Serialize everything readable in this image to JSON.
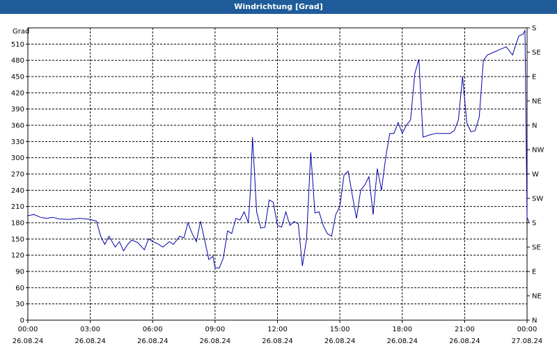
{
  "window": {
    "title": "Windrichtung [Grad]"
  },
  "chart_data": {
    "type": "line",
    "title": "Windrichtung [Grad]",
    "ylabel": "Grad",
    "ylim": [
      0,
      540
    ],
    "y_ticks": [
      0,
      30,
      60,
      90,
      120,
      150,
      180,
      210,
      240,
      270,
      300,
      330,
      360,
      390,
      420,
      450,
      480,
      510
    ],
    "xlim_hours": [
      0,
      24
    ],
    "x_ticks": [
      {
        "hour": 0,
        "time": "00:00",
        "date": "26.08.24"
      },
      {
        "hour": 3,
        "time": "03:00",
        "date": "26.08.24"
      },
      {
        "hour": 6,
        "time": "06:00",
        "date": "26.08.24"
      },
      {
        "hour": 9,
        "time": "09:00",
        "date": "26.08.24"
      },
      {
        "hour": 12,
        "time": "12:00",
        "date": "26.08.24"
      },
      {
        "hour": 15,
        "time": "15:00",
        "date": "26.08.24"
      },
      {
        "hour": 18,
        "time": "18:00",
        "date": "26.08.24"
      },
      {
        "hour": 21,
        "time": "21:00",
        "date": "26.08.24"
      },
      {
        "hour": 24,
        "time": "00:00",
        "date": "27.08.24"
      }
    ],
    "right_axis": [
      {
        "value": 0,
        "label": "N"
      },
      {
        "value": 45,
        "label": "NE"
      },
      {
        "value": 90,
        "label": "E"
      },
      {
        "value": 135,
        "label": "SE"
      },
      {
        "value": 180,
        "label": "S"
      },
      {
        "value": 225,
        "label": "SW"
      },
      {
        "value": 270,
        "label": "W"
      },
      {
        "value": 315,
        "label": "NW"
      },
      {
        "value": 360,
        "label": "N"
      },
      {
        "value": 405,
        "label": "NE"
      },
      {
        "value": 450,
        "label": "E"
      },
      {
        "value": 495,
        "label": "SE"
      },
      {
        "value": 540,
        "label": "S"
      }
    ],
    "grid": true,
    "series": [
      {
        "color": "#0000aa",
        "x": [
          0.0,
          0.3,
          0.6,
          0.9,
          1.2,
          1.5,
          2.0,
          2.5,
          3.0,
          3.3,
          3.5,
          3.7,
          3.9,
          4.2,
          4.4,
          4.6,
          4.8,
          5.0,
          5.3,
          5.6,
          5.8,
          6.0,
          6.2,
          6.5,
          6.8,
          7.0,
          7.3,
          7.5,
          7.7,
          7.9,
          8.1,
          8.3,
          8.5,
          8.7,
          8.9,
          9.0,
          9.2,
          9.4,
          9.6,
          9.8,
          10.0,
          10.2,
          10.4,
          10.6,
          10.7,
          10.8,
          11.0,
          11.2,
          11.4,
          11.6,
          11.8,
          12.0,
          12.2,
          12.4,
          12.6,
          12.8,
          13.0,
          13.2,
          13.4,
          13.6,
          13.8,
          14.0,
          14.2,
          14.4,
          14.6,
          14.8,
          15.0,
          15.2,
          15.4,
          15.6,
          15.8,
          16.0,
          16.2,
          16.4,
          16.6,
          16.8,
          17.0,
          17.2,
          17.4,
          17.6,
          17.8,
          18.0,
          18.2,
          18.4,
          18.6,
          18.8,
          19.0,
          19.3,
          19.6,
          20.0,
          20.3,
          20.5,
          20.7,
          20.9,
          21.1,
          21.3,
          21.5,
          21.7,
          21.9,
          22.1,
          22.4,
          22.7,
          23.0,
          23.3,
          23.6,
          23.8,
          23.9,
          24.0,
          24.1
        ],
        "y": [
          193,
          195,
          190,
          188,
          190,
          187,
          186,
          188,
          186,
          183,
          155,
          140,
          155,
          135,
          145,
          128,
          140,
          148,
          143,
          130,
          150,
          145,
          142,
          135,
          145,
          140,
          155,
          152,
          180,
          160,
          145,
          183,
          148,
          112,
          118,
          97,
          96,
          115,
          165,
          160,
          188,
          185,
          200,
          180,
          240,
          338,
          200,
          170,
          172,
          222,
          218,
          175,
          172,
          200,
          175,
          182,
          178,
          100,
          150,
          310,
          198,
          200,
          175,
          160,
          155,
          195,
          210,
          268,
          275,
          230,
          188,
          240,
          250,
          265,
          195,
          280,
          240,
          300,
          345,
          345,
          365,
          345,
          360,
          370,
          455,
          482,
          338,
          342,
          345,
          345,
          345,
          350,
          370,
          450,
          365,
          348,
          350,
          375,
          480,
          490,
          495,
          500,
          505,
          490,
          525,
          528,
          535,
          190,
          180
        ]
      }
    ]
  }
}
